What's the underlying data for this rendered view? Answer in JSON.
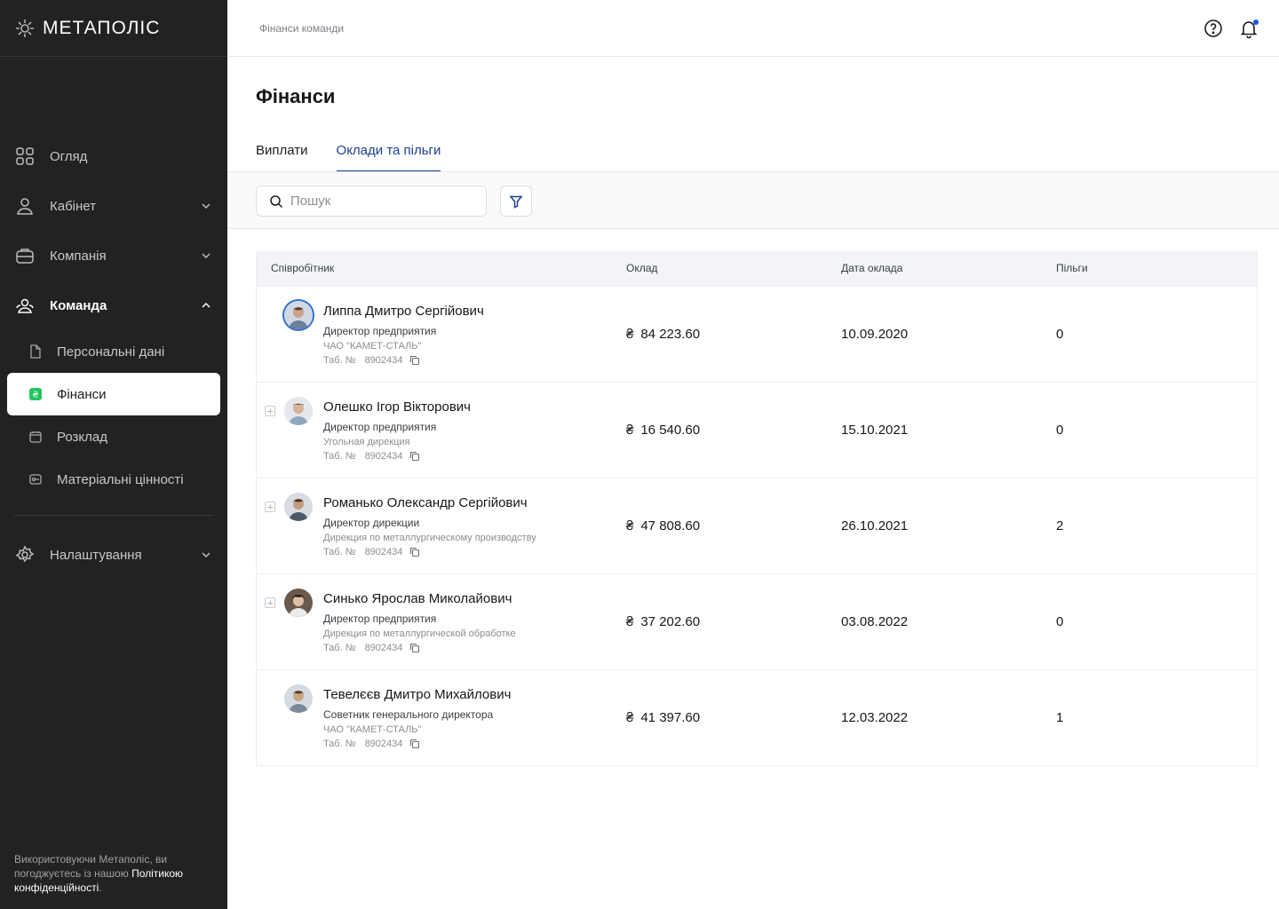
{
  "app": {
    "logo_text": "МЕТАПОЛІС"
  },
  "sidebar": {
    "items": [
      {
        "label": "Огляд",
        "icon": "grid-icon"
      },
      {
        "label": "Кабінет",
        "icon": "user-icon"
      },
      {
        "label": "Компанія",
        "icon": "briefcase-icon"
      },
      {
        "label": "Команда",
        "icon": "team-icon"
      }
    ],
    "sub_items": [
      {
        "label": "Персональні дані",
        "icon": "document-icon"
      },
      {
        "label": "Фінанси",
        "icon": "money-icon"
      },
      {
        "label": "Розклад",
        "icon": "calendar-icon"
      },
      {
        "label": "Матеріальні цінності",
        "icon": "asset-icon"
      }
    ],
    "settings_label": "Налаштування",
    "footer_text": "Використовуючи Метаполіс, ви погоджуєтесь із нашою",
    "footer_link": "Політикою конфіденційності",
    "footer_end": ".",
    "accent_color": "#22c55e"
  },
  "header": {
    "breadcrumb": "Фінанси команди"
  },
  "main": {
    "title": "Фінанси",
    "tabs": [
      {
        "label": "Виплати",
        "active": false
      },
      {
        "label": "Оклади та пільги",
        "active": true
      }
    ],
    "search_placeholder": "Пошук",
    "table": {
      "headers": [
        "Співробітник",
        "Оклад",
        "Дата оклада",
        "Пільги"
      ],
      "tab_prefix": "Таб. №",
      "currency": "₴",
      "rows": [
        {
          "name": "Липпа Дмитро Сергійович",
          "position": "Директор предприятия",
          "dept": "ЧАО \"КАМЕТ-СТАЛЬ\"",
          "tab_no": "8902434",
          "salary": "84 223.60",
          "date": "10.09.2020",
          "benefits": "0"
        },
        {
          "name": "Олешко Ігор Вікторович",
          "position": "Директор предприятия",
          "dept": "Угольная дирекция",
          "tab_no": "8902434",
          "salary": "16 540.60",
          "date": "15.10.2021",
          "benefits": "0"
        },
        {
          "name": "Романько Олександр Сергійович",
          "position": "Директор дирекции",
          "dept": "Дирекция по металлургическому производству",
          "tab_no": "8902434",
          "salary": "47 808.60",
          "date": "26.10.2021",
          "benefits": "2"
        },
        {
          "name": "Синько Ярослав Миколайович",
          "position": "Директор предприятия",
          "dept": "Дирекция по металлургической обработке",
          "tab_no": "8902434",
          "salary": "37 202.60",
          "date": "03.08.2022",
          "benefits": "0"
        },
        {
          "name": "Тевелєєв Дмитро Михайлович",
          "position": "Советник генерального директора",
          "dept": "ЧАО \"КАМЕТ-СТАЛЬ\"",
          "tab_no": "8902434",
          "salary": "41 397.60",
          "date": "12.03.2022",
          "benefits": "1"
        }
      ]
    }
  },
  "colors": {
    "sidebar_bg": "#222222",
    "accent_blue": "#1a3f8f",
    "notification": "#1a56db"
  }
}
